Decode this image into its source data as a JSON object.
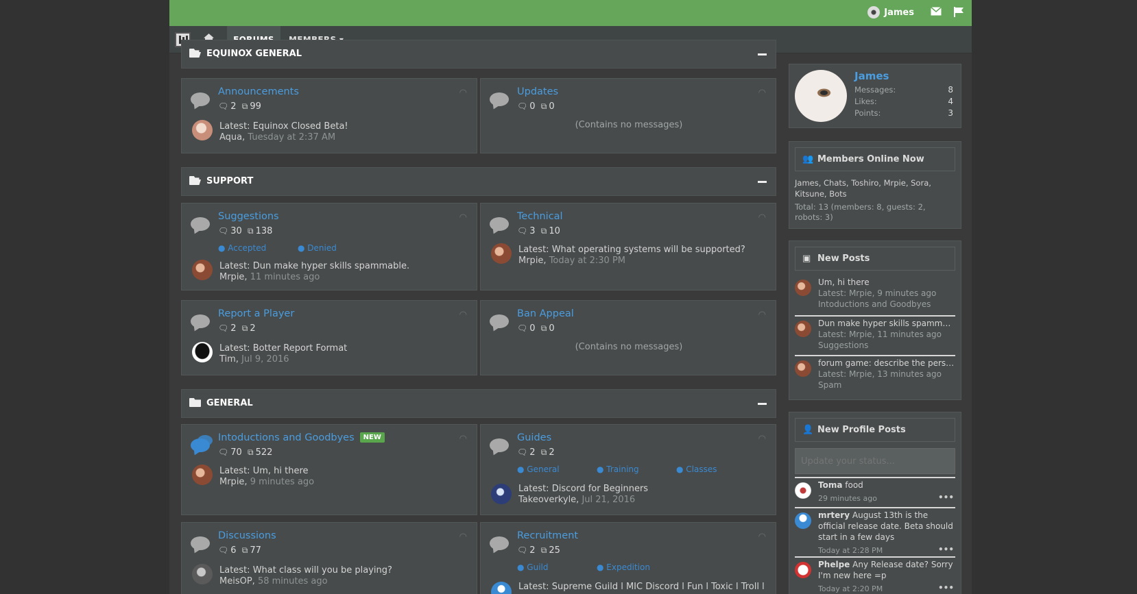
{
  "topbar": {
    "username": "James",
    "icons": [
      "envelope-icon",
      "flag-icon"
    ]
  },
  "nav": {
    "home_icon": "home-icon",
    "tabs": [
      {
        "label": "FORUMS",
        "active": true
      },
      {
        "label": "MEMBERS ▾",
        "active": false
      }
    ]
  },
  "categories": [
    {
      "title": "EQUINOX GENERAL"
    },
    {
      "title": "SUPPORT"
    },
    {
      "title": "GENERAL"
    }
  ],
  "nodes": {
    "announcements": {
      "name": "Announcements",
      "threads": "2",
      "posts": "99",
      "latest_label": "Latest:",
      "latest_title": "Equinox Closed Beta!",
      "latest_user": "Aqua,",
      "latest_time": "Tuesday at 2:37 AM"
    },
    "updates": {
      "name": "Updates",
      "threads": "0",
      "posts": "0",
      "empty": "(Contains no messages)"
    },
    "suggestions": {
      "name": "Suggestions",
      "threads": "30",
      "posts": "138",
      "subs": [
        "Accepted",
        "Denied"
      ],
      "latest_label": "Latest:",
      "latest_title": "Dun make hyper skills spammable.",
      "latest_user": "Mrpie,",
      "latest_time": "11 minutes ago"
    },
    "technical": {
      "name": "Technical",
      "threads": "3",
      "posts": "10",
      "latest_label": "Latest:",
      "latest_title": "What operating systems will be supported?",
      "latest_user": "Mrpie,",
      "latest_time": "Today at 2:30 PM"
    },
    "report": {
      "name": "Report a Player",
      "threads": "2",
      "posts": "2",
      "latest_label": "Latest:",
      "latest_title": "Botter Report Format",
      "latest_user": "Tim,",
      "latest_time": "Jul 9, 2016"
    },
    "ban": {
      "name": "Ban Appeal",
      "threads": "0",
      "posts": "0",
      "empty": "(Contains no messages)"
    },
    "intro": {
      "name": "Intoductions and Goodbyes",
      "badge": "NEW",
      "threads": "70",
      "posts": "522",
      "latest_label": "Latest:",
      "latest_title": "Um, hi there",
      "latest_user": "Mrpie,",
      "latest_time": "9 minutes ago"
    },
    "guides": {
      "name": "Guides",
      "threads": "2",
      "posts": "2",
      "subs": [
        "General",
        "Training",
        "Classes"
      ],
      "latest_label": "Latest:",
      "latest_title": "Discord for Beginners",
      "latest_user": "Takeoverkyle,",
      "latest_time": "Jul 21, 2016"
    },
    "discussions": {
      "name": "Discussions",
      "threads": "6",
      "posts": "77",
      "latest_label": "Latest:",
      "latest_title": "What class will you be playing?",
      "latest_user": "MeisOP,",
      "latest_time": "58 minutes ago"
    },
    "recruitment": {
      "name": "Recruitment",
      "threads": "2",
      "posts": "25",
      "subs": [
        "Guild",
        "Expedition"
      ],
      "latest_label": "Latest:",
      "latest_title": "Supreme Guild l MIC Discord l Fun l Toxic l Troll l ..."
    }
  },
  "profile": {
    "name": "James",
    "messages_label": "Messages:",
    "messages": "8",
    "likes_label": "Likes:",
    "likes": "4",
    "points_label": "Points:",
    "points": "3"
  },
  "online": {
    "title": "Members Online Now",
    "members": "James, Chats, Toshiro, Mrpie, Sora, Kitsune, Bots",
    "total": "Total: 13 (members: 8, guests: 2, robots: 3)"
  },
  "new_posts": {
    "title": "New Posts",
    "items": [
      {
        "title": "Um, hi there",
        "meta": "Latest: Mrpie, 9 minutes ago",
        "forum": "Intoductions and Goodbyes"
      },
      {
        "title": "Dun make hyper skills spammable.",
        "meta": "Latest: Mrpie, 11 minutes ago",
        "forum": "Suggestions"
      },
      {
        "title": "forum game: describe the person...",
        "meta": "Latest: Mrpie, 13 minutes ago",
        "forum": "Spam"
      }
    ]
  },
  "profile_posts": {
    "title": "New Profile Posts",
    "placeholder": "Update your status...",
    "items": [
      {
        "user": "Toma",
        "text": "food",
        "time": "29 minutes ago",
        "more": "•••"
      },
      {
        "user": "mrtery",
        "text": "August 13th is the official release date. Beta should start in a few days",
        "time": "Today at 2:28 PM",
        "more": "•••"
      },
      {
        "user": "Phelpe",
        "text": "Any Release date? Sorry I'm new here =p",
        "time": "Today at 2:20 PM",
        "more": "•••"
      }
    ]
  }
}
